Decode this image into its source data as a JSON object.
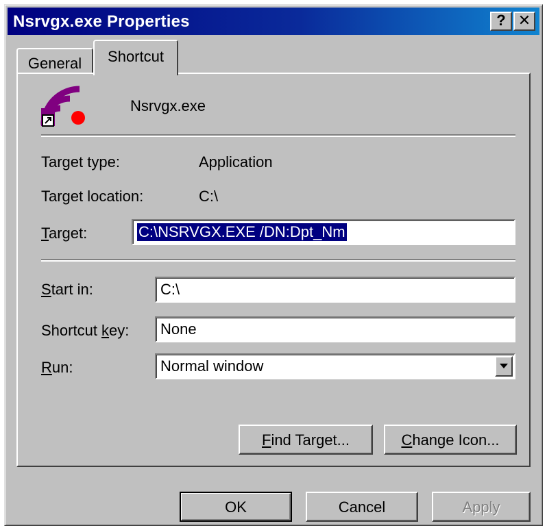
{
  "window": {
    "title": "Nsrvgx.exe Properties",
    "help_label": "?",
    "close_label": "✕"
  },
  "tabs": [
    {
      "label": "General",
      "active": false
    },
    {
      "label": "Shortcut",
      "active": true
    }
  ],
  "shortcut": {
    "icon": "shortcut-app-icon",
    "name": "Nsrvgx.exe",
    "target_type_label": "Target type:",
    "target_type_value": "Application",
    "target_location_label": "Target location:",
    "target_location_value": "C:\\",
    "target_label": "Target:",
    "target_value": "C:\\NSRVGX.EXE /DN:Dpt_Nm",
    "start_in_label": "Start in:",
    "start_in_value": "C:\\",
    "shortcut_key_label": "Shortcut key:",
    "shortcut_key_value": "None",
    "run_label": "Run:",
    "run_value": "Normal window",
    "find_target_label": "Find Target...",
    "change_icon_label": "Change Icon..."
  },
  "footer": {
    "ok_label": "OK",
    "cancel_label": "Cancel",
    "apply_label": "Apply"
  },
  "colors": {
    "titlebar": "#000080",
    "face": "#c0c0c0",
    "selection": "#000080",
    "icon_arcs": "#800080",
    "icon_dot": "#ff0000"
  }
}
